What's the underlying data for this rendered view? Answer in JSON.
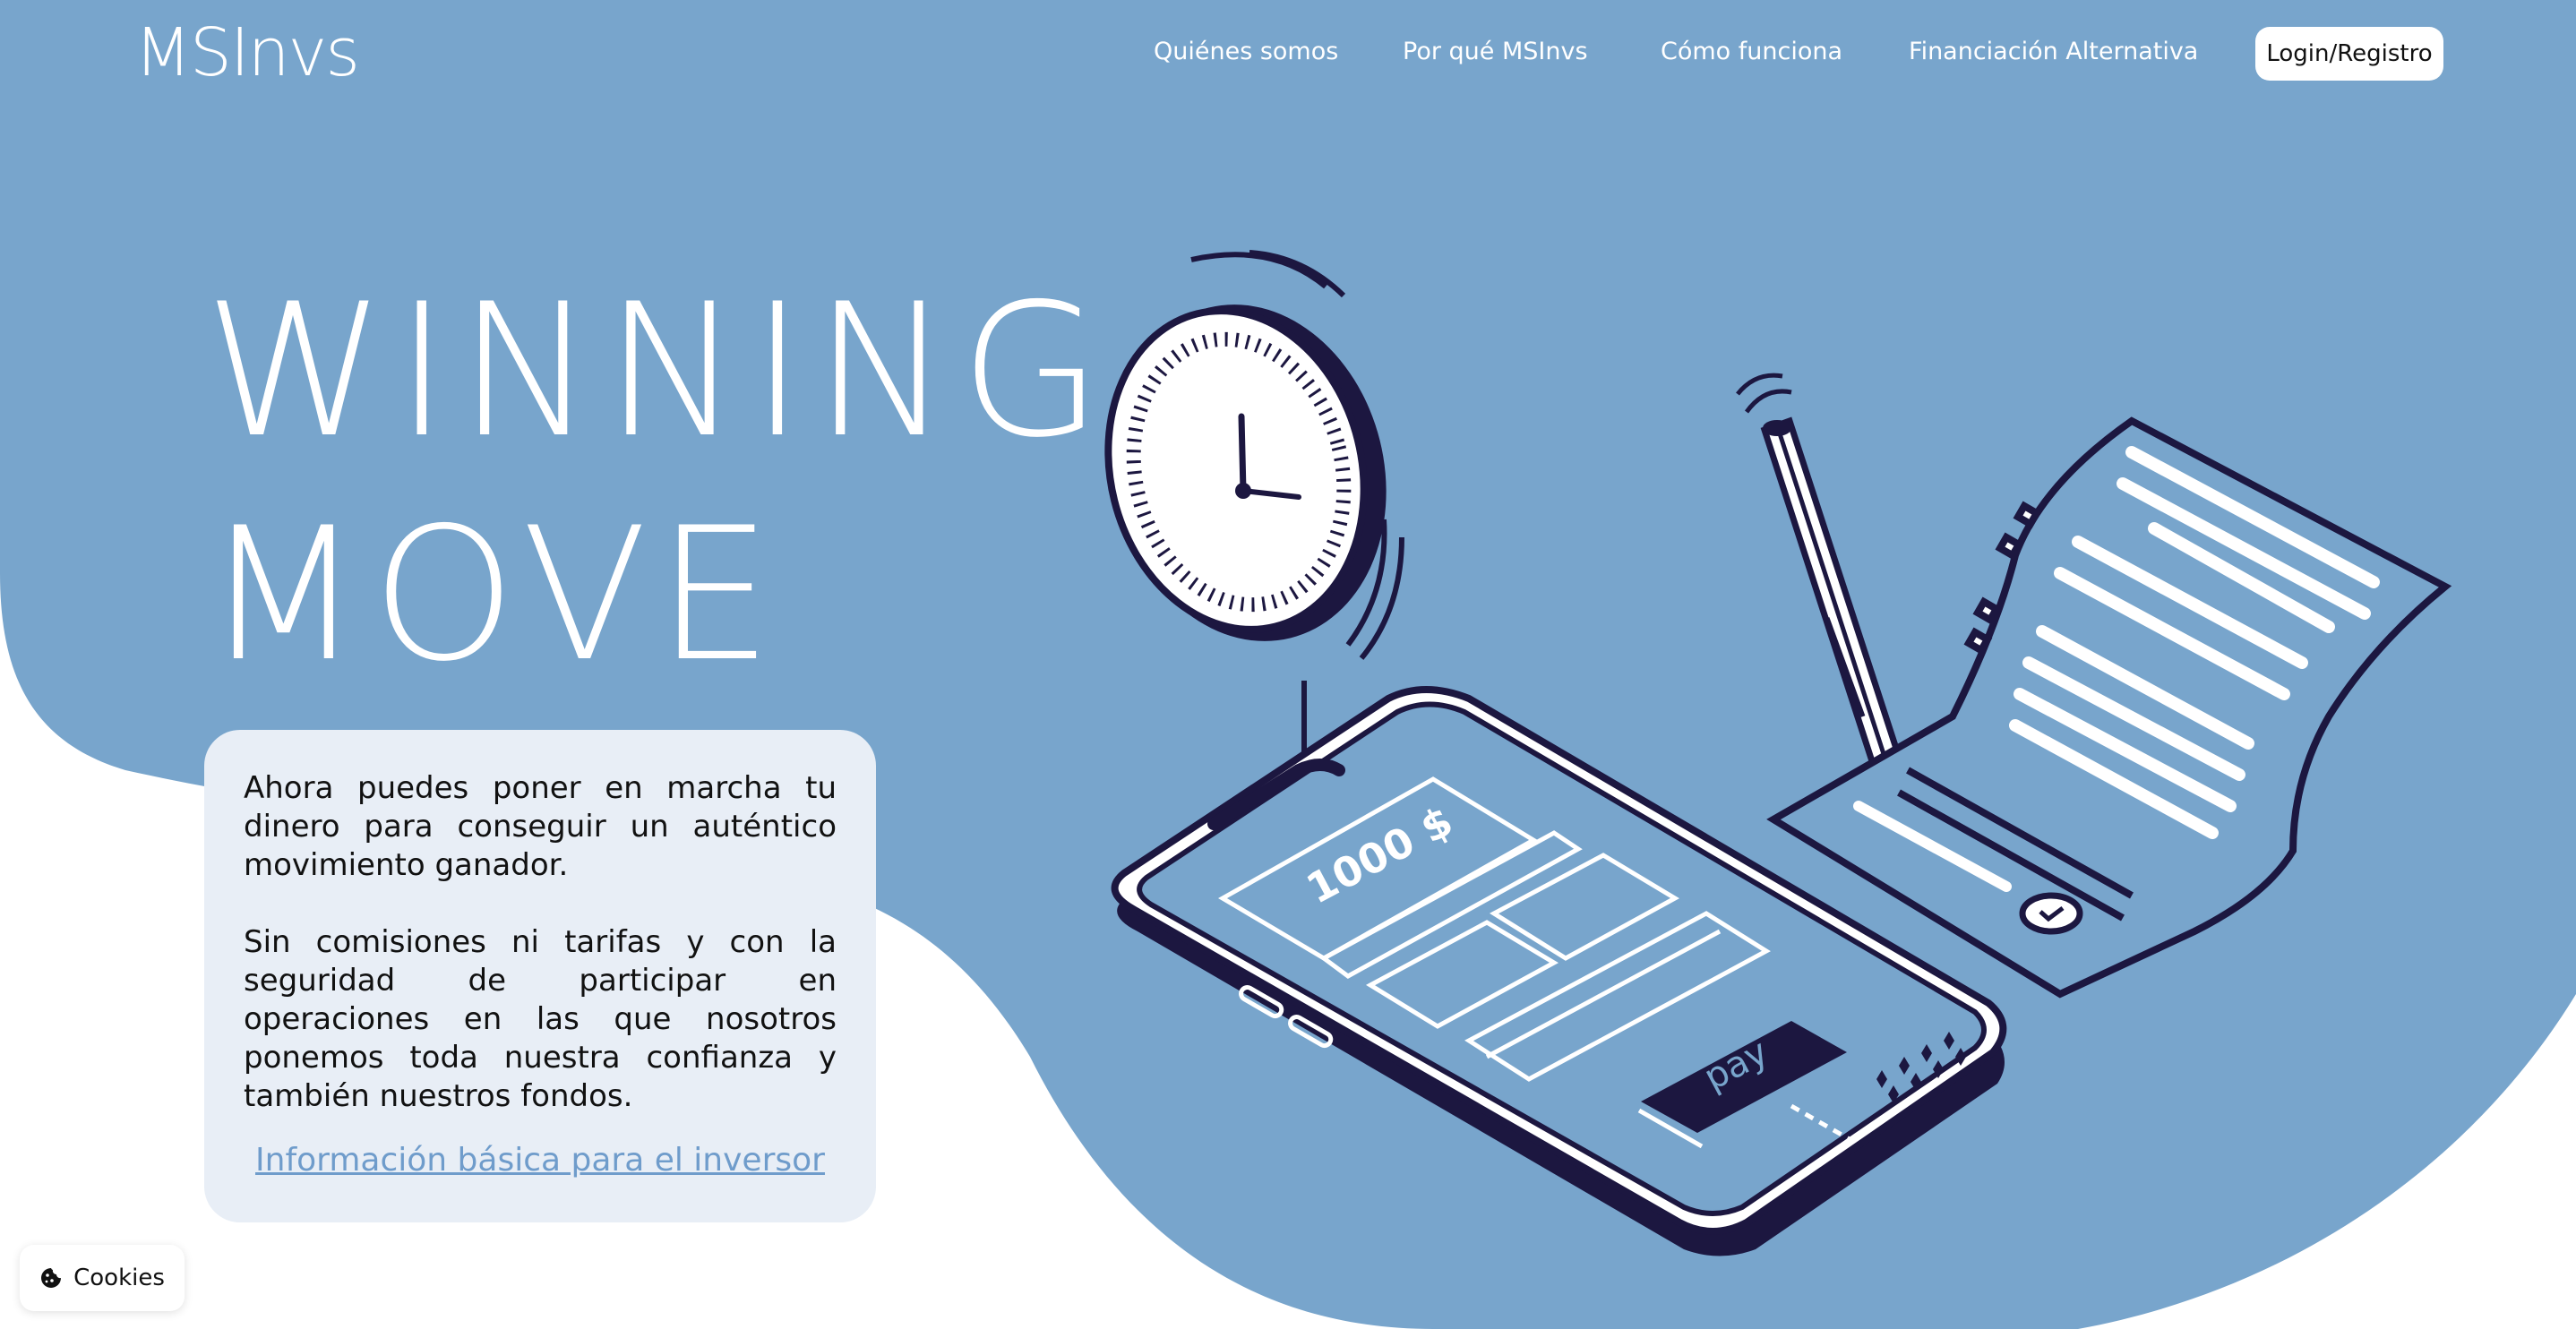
{
  "brand": {
    "logo_text": "MSInvs"
  },
  "nav": {
    "links": [
      "Quiénes somos",
      "Por qué MSInvs",
      "Cómo funciona",
      "Financiación Alternativa"
    ],
    "login_label": "Login/Registro"
  },
  "hero": {
    "title_line1": "WINNING",
    "title_line2": "MOVE",
    "paragraph1": "Ahora puedes poner en marcha tu dinero para conseguir un auténtico movimiento ganador.",
    "paragraph2": "Sin comisiones ni tarifas y con la seguridad de participar en operaciones en las que nosotros ponemos toda nuestra confianza y también nuestros fondos.",
    "info_link": "Información básica para el inversor"
  },
  "illustration": {
    "amount_text": "1000 $",
    "pay_text": "pay",
    "icons": [
      "stopwatch-icon",
      "smartphone-icon",
      "pen-icon",
      "contract-document-icon"
    ]
  },
  "cookies": {
    "label": "Cookies",
    "icon": "cookie-icon"
  },
  "colors": {
    "primary_blue": "#78a5cc",
    "card_bg": "#e8eef6",
    "navy": "#1c1740",
    "link_blue": "#6f9ccb",
    "white": "#ffffff"
  }
}
